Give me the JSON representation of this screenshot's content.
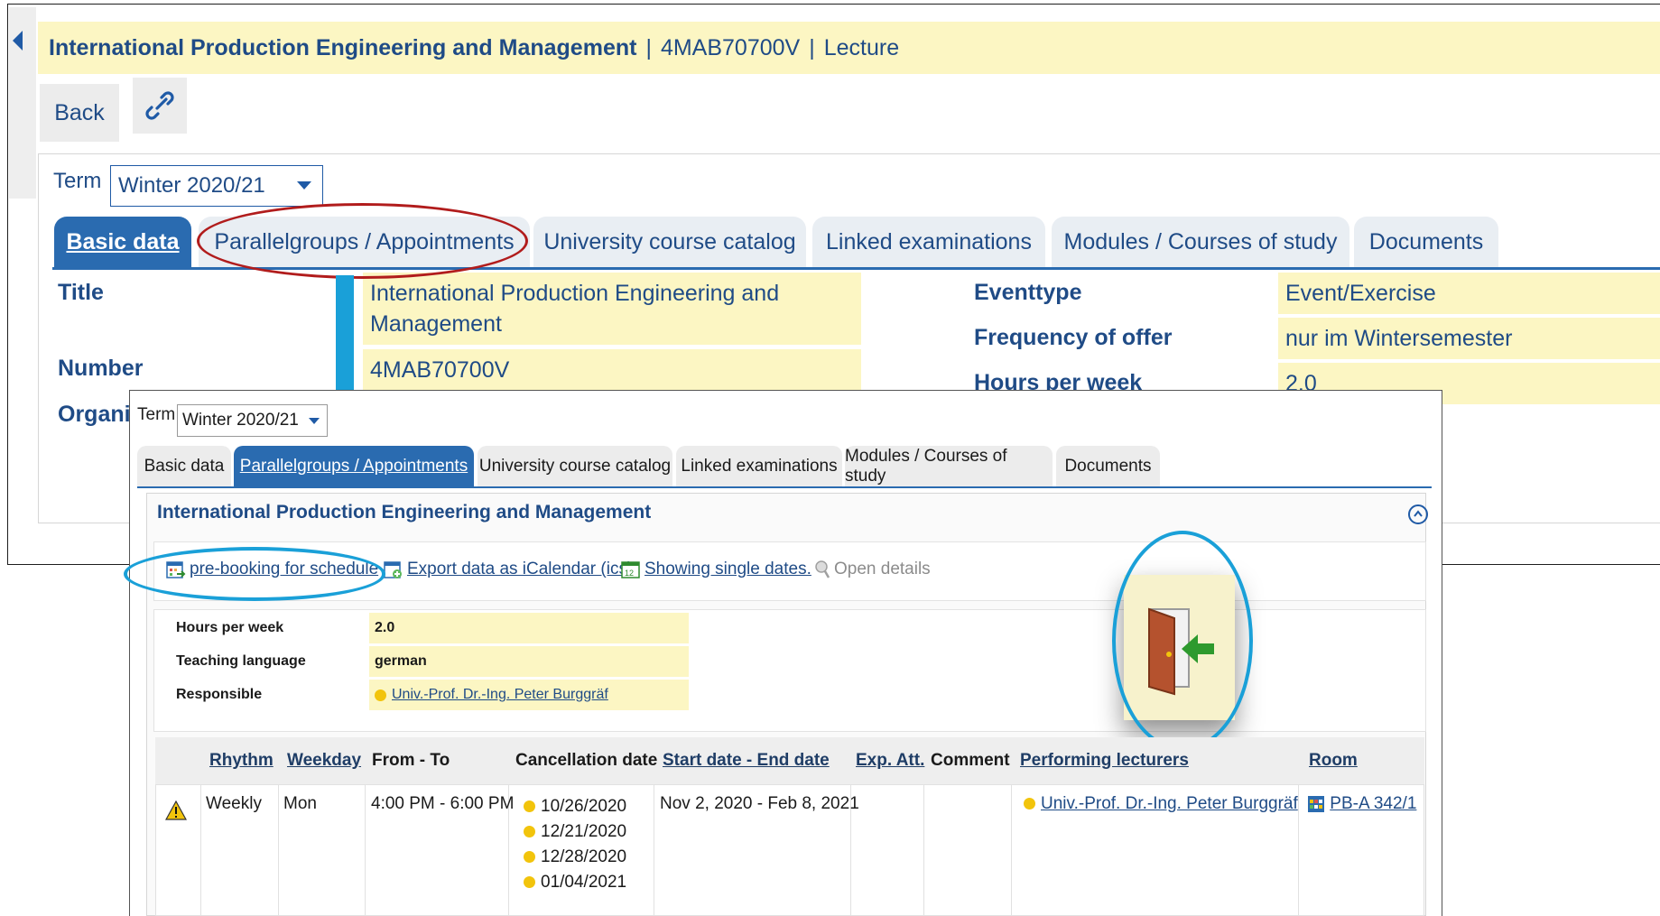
{
  "header": {
    "course_title": "International Production Engineering and Management",
    "separator": "|",
    "course_number": "4MAB70700V",
    "course_type": "Lecture"
  },
  "toolbar": {
    "back_label": "Back",
    "link_icon": "chain-link-icon"
  },
  "term": {
    "label": "Term",
    "value": "Winter 2020/21"
  },
  "tabs": [
    {
      "label": "Basic data"
    },
    {
      "label": "Parallelgroups / Appointments"
    },
    {
      "label": "University course catalog"
    },
    {
      "label": "Linked examinations"
    },
    {
      "label": "Modules / Courses of study"
    },
    {
      "label": "Documents"
    }
  ],
  "basic": {
    "title_label": "Title",
    "title_value": "International Production Engineering and Management",
    "number_label": "Number",
    "number_value": "4MAB70700V",
    "org_label_partial": "Organi",
    "eventtype_label": "Eventtype",
    "eventtype_value": "Event/Exercise",
    "frequency_label": "Frequency of offer",
    "frequency_value": "nur im Wintersemester",
    "hours_label": "Hours per week",
    "hours_value": "2.0"
  },
  "popup": {
    "term_label": "Term",
    "term_value": "Winter 2020/21",
    "group_title": "International Production Engineering and Management",
    "actions": {
      "prebook": "pre-booking for schedule",
      "export": "Export data as iCalendar (ics)",
      "single_dates": "Showing single dates.",
      "open_details": "Open details"
    },
    "details": {
      "hours_label": "Hours per week",
      "hours_value": "2.0",
      "language_label": "Teaching language",
      "language_value": "german",
      "responsible_label": "Responsible",
      "responsible_value": "Univ.-Prof. Dr.-Ing. Peter Burggräf"
    },
    "table": {
      "headers": {
        "rhythm": "Rhythm",
        "weekday": "Weekday",
        "from_to": "From - To",
        "cancellation": "Cancellation date",
        "start_end": "Start date - End date",
        "exp_att": "Exp. Att.",
        "comment": "Comment",
        "lecturers": "Performing lecturers",
        "room": "Room"
      },
      "row": {
        "rhythm": "Weekly",
        "weekday": "Mon",
        "from_to": "4:00 PM - 6:00 PM",
        "cancellation_dates": [
          "10/26/2020",
          "12/21/2020",
          "12/28/2020",
          "01/04/2021"
        ],
        "start_end": "Nov 2, 2020 - Feb 8, 2021",
        "lecturer": "Univ.-Prof. Dr.-Ing. Peter Burggräf",
        "room": "PB-A 342/1"
      }
    }
  },
  "colors": {
    "accent_blue": "#2a6bb0",
    "highlight_yellow": "#fcf6c3",
    "annotation_red": "#b11c1c",
    "annotation_cyan": "#1aa0d8"
  }
}
